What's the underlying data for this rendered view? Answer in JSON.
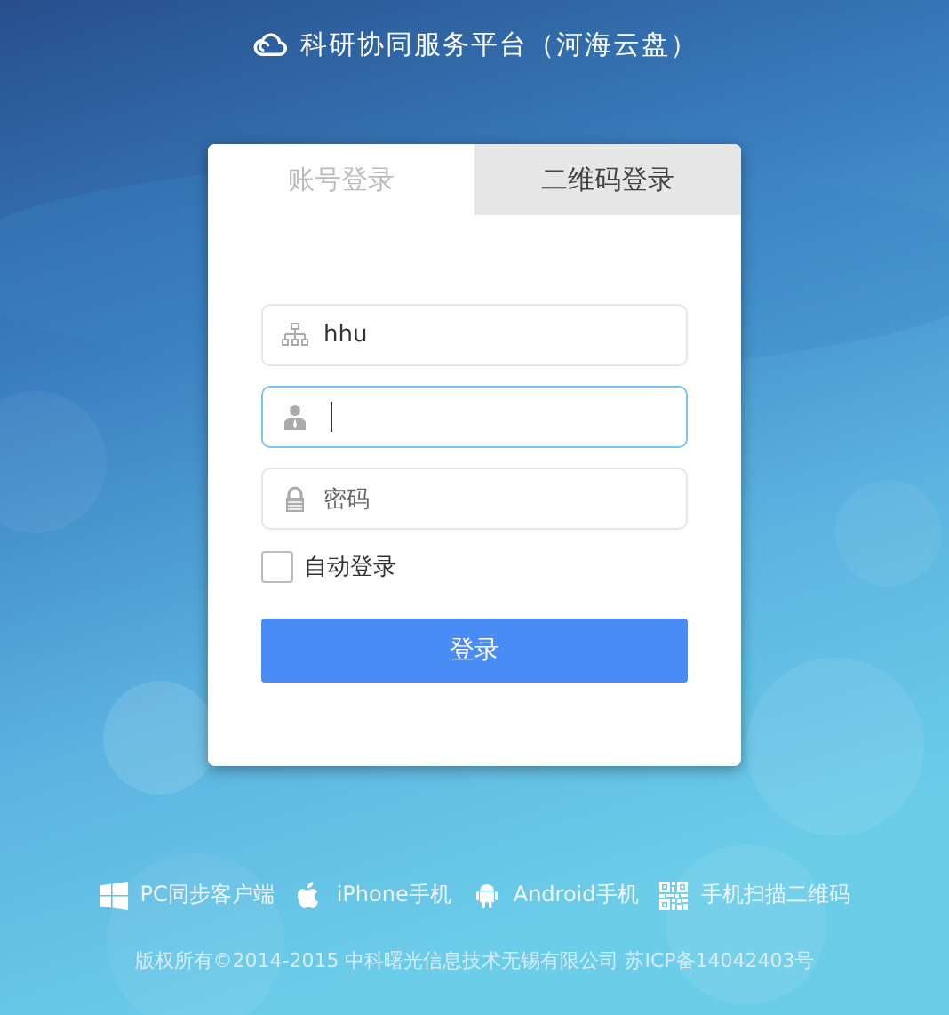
{
  "header": {
    "title": "科研协同服务平台（河海云盘）"
  },
  "tabs": [
    {
      "label": "账号登录",
      "selected": true
    },
    {
      "label": "二维码登录",
      "selected": false
    }
  ],
  "fields": [
    {
      "kind": "org",
      "value": "hhu",
      "focused": false
    },
    {
      "kind": "user",
      "focused": true
    },
    {
      "kind": "password",
      "placeholder": "密码",
      "focused": false
    }
  ],
  "auto_login": {
    "label": "自动登录",
    "checked": false
  },
  "login_button": "登录",
  "downloads": [
    {
      "kind": "windows",
      "label": "PC同步客户端"
    },
    {
      "kind": "apple",
      "label": "iPhone手机"
    },
    {
      "kind": "android",
      "label": "Android手机"
    },
    {
      "kind": "qr",
      "label": "手机扫描二维码"
    }
  ],
  "copyright": "版权所有©2014-2015 中科曙光信息技术无锡有限公司 苏ICP备14042403号"
}
